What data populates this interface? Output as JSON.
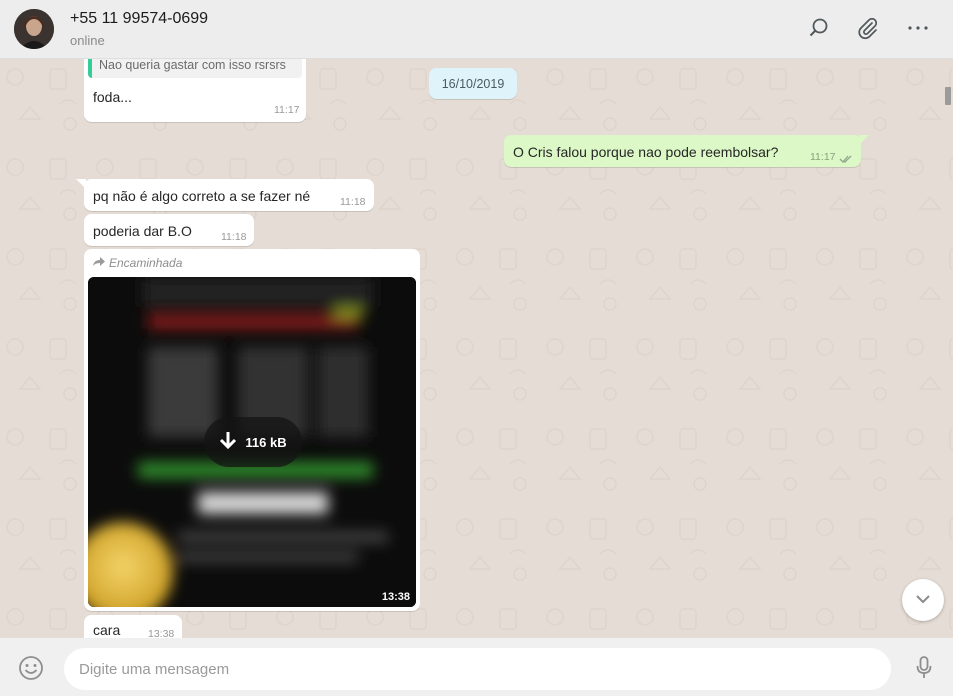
{
  "header": {
    "contact_name": "+55 11 99574-0699",
    "status": "online",
    "icons": [
      "search-icon",
      "attach-icon",
      "menu-icon"
    ]
  },
  "chat": {
    "date_divider": "16/10/2019",
    "messages": [
      {
        "direction": "in",
        "quoted_text": "Nao queria gastar com isso rsrsrs",
        "text": "foda...",
        "time": "11:17"
      },
      {
        "direction": "out",
        "text": "O Cris falou porque nao pode reembolsar?",
        "time": "11:17",
        "status": "read"
      },
      {
        "direction": "in",
        "text": "pq não é algo correto a se fazer né",
        "time": "11:18"
      },
      {
        "direction": "in",
        "text": "poderia dar B.O",
        "time": "11:18"
      },
      {
        "direction": "in",
        "type": "image",
        "forwarded_label": "Encaminhada",
        "download_size": "116 kB",
        "time": "13:38"
      },
      {
        "direction": "in",
        "text": "cara",
        "time": "13:38"
      }
    ]
  },
  "footer": {
    "input_placeholder": "Digite uma mensagem",
    "input_value": ""
  },
  "colors": {
    "chat_bg": "#e5ddd5",
    "outgoing_bubble": "#dcf8c6",
    "incoming_bubble": "#ffffff",
    "date_pill": "#dff3fb",
    "quote_bar": "#35cd96",
    "read_ticks": "#4fc3f7"
  }
}
